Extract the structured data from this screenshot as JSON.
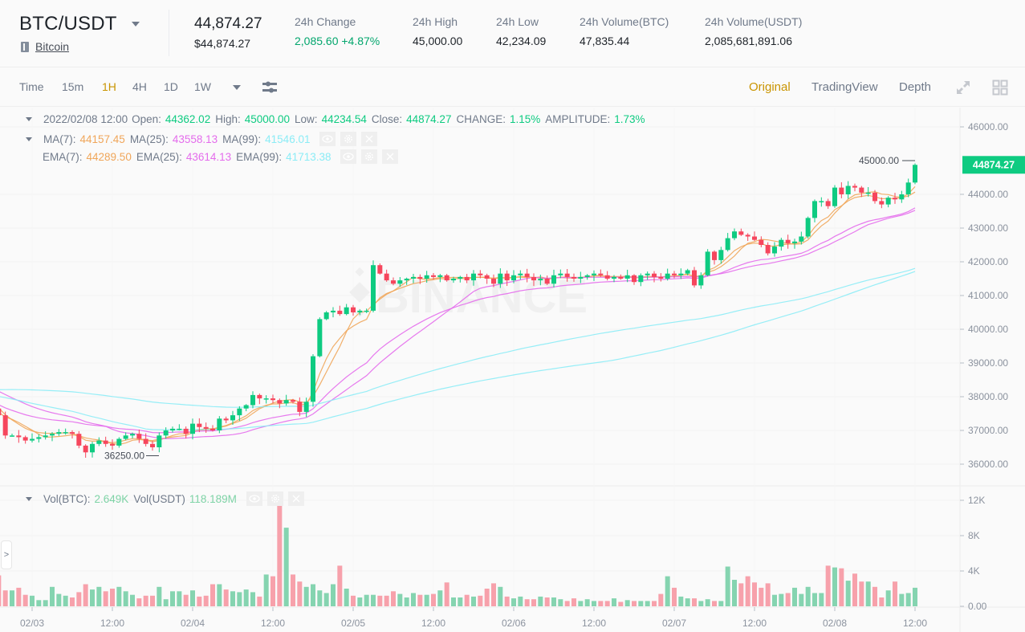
{
  "header": {
    "pair": "BTC/USDT",
    "coin_name": "Bitcoin",
    "last_price": "44,874.27",
    "last_price_usd": "$44,874.27",
    "stats": [
      {
        "label": "24h Change",
        "value": "2,085.60 +4.87%",
        "up": true
      },
      {
        "label": "24h High",
        "value": "45,000.00"
      },
      {
        "label": "24h Low",
        "value": "42,234.09"
      },
      {
        "label": "24h Volume(BTC)",
        "value": "47,835.44"
      },
      {
        "label": "24h Volume(USDT)",
        "value": "2,085,681,891.06"
      }
    ]
  },
  "toolbar": {
    "intervals": [
      "Time",
      "15m",
      "1H",
      "4H",
      "1D",
      "1W"
    ],
    "active_interval": "1H",
    "views": [
      "Original",
      "TradingView",
      "Depth"
    ],
    "active_view": "Original"
  },
  "legend": {
    "ohlc": {
      "datetime": "2022/02/08 12:00",
      "open_label": "Open:",
      "open": "44362.02",
      "high_label": "High:",
      "high": "45000.00",
      "low_label": "Low:",
      "low": "44234.54",
      "close_label": "Close:",
      "close": "44874.27",
      "change_label": "CHANGE:",
      "change": "1.15%",
      "amplitude_label": "AMPLITUDE:",
      "amplitude": "1.73%"
    },
    "ma": [
      {
        "label": "MA(7):",
        "value": "44157.45"
      },
      {
        "label": "MA(25):",
        "value": "43558.13"
      },
      {
        "label": "MA(99):",
        "value": "41546.01"
      }
    ],
    "ema": [
      {
        "label": "EMA(7):",
        "value": "44289.50"
      },
      {
        "label": "EMA(25):",
        "value": "43614.13"
      },
      {
        "label": "EMA(99):",
        "value": "41713.38"
      }
    ],
    "vol": [
      {
        "label": "Vol(BTC):",
        "value": "2.649K"
      },
      {
        "label": "Vol(USDT)",
        "value": "118.189M"
      }
    ]
  },
  "colors": {
    "up": "#0ecb81",
    "down": "#f6465d",
    "vol_up": "#85d4b0",
    "vol_down": "#f7a1ab",
    "ma7": "#f0a65a",
    "ma25": "#e46cec",
    "ma99": "#8cecf6",
    "accent": "#c99400"
  },
  "chart_data": {
    "type": "candlestick",
    "title": "BTC/USDT 1H",
    "interval": "1H",
    "price_axis": {
      "ticks": [
        "46000.00",
        "45000.00",
        "44000.00",
        "43000.00",
        "42000.00",
        "41000.00",
        "40000.00",
        "39000.00",
        "38000.00",
        "37000.00",
        "36000.00"
      ],
      "tick_values": [
        46000,
        44000,
        43000,
        42000,
        41000,
        40000,
        39000,
        38000,
        37000,
        36000
      ],
      "tick_labels": [
        "46000.00",
        "44000.00",
        "43000.00",
        "42000.00",
        "41000.00",
        "40000.00",
        "39000.00",
        "38000.00",
        "37000.00",
        "36000.00"
      ],
      "range": [
        35600,
        46400
      ]
    },
    "volume_axis": {
      "tick_values": [
        12000,
        8000,
        4000,
        0
      ],
      "tick_labels": [
        "12K",
        "8K",
        "4K",
        "0.00"
      ],
      "range": [
        0,
        12500
      ]
    },
    "x_ticks": [
      "02/03",
      "12:00",
      "02/04",
      "12:00",
      "02/05",
      "12:00",
      "02/06",
      "12:00",
      "02/07",
      "12:00",
      "02/08",
      "12:00"
    ],
    "current_price_label": "44874.27",
    "max_marker": {
      "label": "45000.00",
      "value": 45000
    },
    "min_marker": {
      "label": "36250.00",
      "value": 36250
    },
    "watermark": "BINANCE",
    "closes": [
      38650,
      38450,
      37800,
      37350,
      37450,
      37500,
      37550,
      37650,
      37450,
      36850,
      36850,
      36800,
      36700,
      36750,
      36800,
      36850,
      36900,
      36950,
      36950,
      36900,
      36550,
      36350,
      36600,
      36700,
      36600,
      36550,
      36750,
      36850,
      36900,
      36750,
      36600,
      36500,
      36850,
      37000,
      37050,
      37050,
      36900,
      37200,
      37100,
      37050,
      37000,
      37350,
      37300,
      37450,
      37650,
      37750,
      38050,
      37950,
      37950,
      37900,
      37800,
      37900,
      37850,
      37550,
      37850,
      39200,
      40300,
      40500,
      40550,
      40450,
      40650,
      40500,
      40550,
      40550,
      41900,
      41650,
      41450,
      41350,
      41450,
      41500,
      41550,
      41500,
      41600,
      41550,
      41600,
      41450,
      41500,
      41550,
      41450,
      41650,
      41600,
      41500,
      41350,
      41650,
      41450,
      41600,
      41650,
      41550,
      41450,
      41500,
      41350,
      41600,
      41650,
      41550,
      41500,
      41550,
      41600,
      41650,
      41600,
      41500,
      41550,
      41500,
      41600,
      41400,
      41600,
      41650,
      41550,
      41500,
      41650,
      41600,
      41650,
      41750,
      41300,
      41600,
      42300,
      42050,
      42350,
      42700,
      42900,
      42800,
      42750,
      42650,
      42500,
      42250,
      42450,
      42650,
      42550,
      42600,
      42750,
      43300,
      43800,
      43800,
      43650,
      44200,
      44000,
      44250,
      44200,
      44050,
      44050,
      43800,
      43700,
      43900,
      43850,
      44000,
      44350,
      44874.27
    ],
    "volumes": [
      1500,
      4300,
      3500,
      3500,
      1500,
      1000,
      1300,
      1800,
      3500,
      1800,
      1800,
      2100,
      1300,
      1200,
      700,
      700,
      2200,
      1400,
      1200,
      1000,
      1600,
      2500,
      1900,
      2200,
      1700,
      2000,
      2200,
      1700,
      1300,
      900,
      1200,
      1200,
      2200,
      800,
      1700,
      1700,
      1300,
      1800,
      1100,
      1200,
      2500,
      2500,
      1900,
      1700,
      1600,
      1900,
      1600,
      1100,
      3600,
      3400,
      12300,
      8900,
      3600,
      2800,
      2200,
      2500,
      1800,
      1500,
      2500,
      4600,
      2000,
      1200,
      1000,
      1300,
      1300,
      1200,
      1200,
      1700,
      1400,
      1000,
      1500,
      1300,
      1300,
      1400,
      1800,
      2700,
      1000,
      1000,
      1300,
      1100,
      1200,
      2000,
      2600,
      2200,
      1100,
      900,
      1100,
      800,
      800,
      1100,
      1000,
      1000,
      800,
      600,
      900,
      600,
      800,
      600,
      600,
      600,
      900,
      500,
      700,
      600,
      600,
      600,
      600,
      1400,
      3400,
      2100,
      1100,
      900,
      900,
      600,
      800,
      600,
      600,
      4500,
      3000,
      2600,
      3400,
      2700,
      2100,
      2600,
      1300,
      1400,
      1500,
      2100,
      1400,
      2200,
      1500,
      1500,
      4600,
      4400,
      4300,
      2900,
      3700,
      2800,
      2800,
      2200,
      1000,
      1800,
      2800,
      1400,
      1500,
      2100,
      2100,
      2649
    ]
  },
  "side_toggle": ">"
}
